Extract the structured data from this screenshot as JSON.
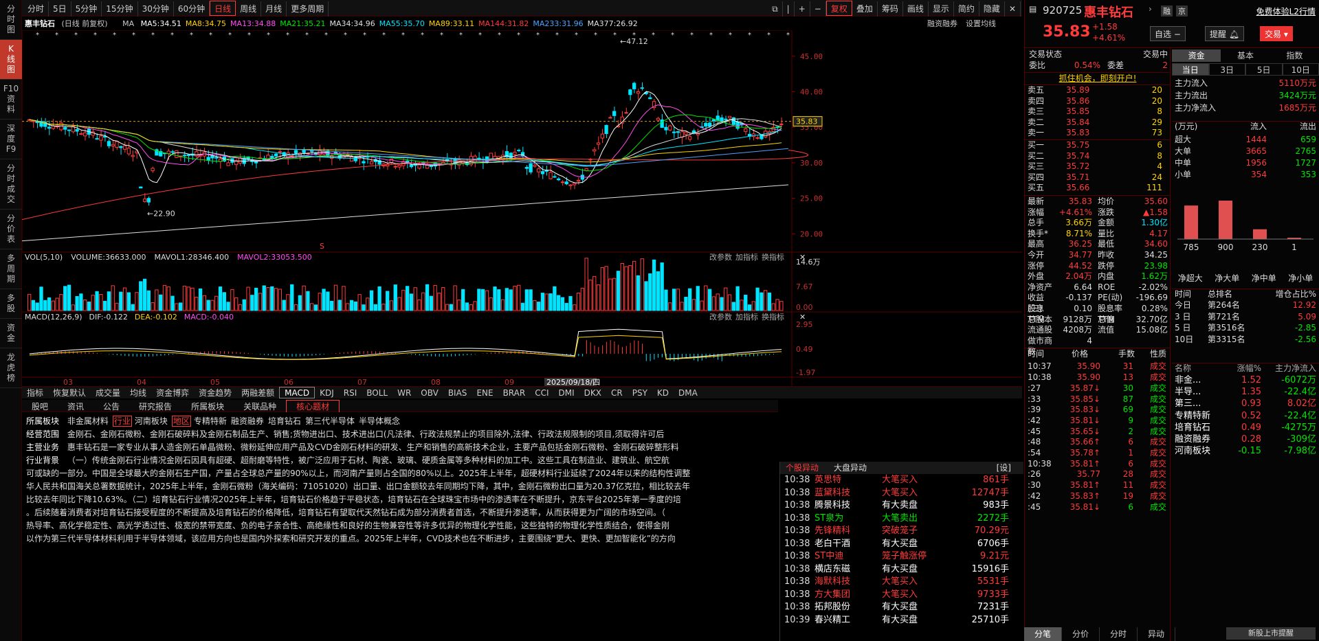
{
  "leftnav": [
    "分时图",
    "K线图",
    "F10资料",
    "深度F9",
    "分时成交",
    "分价表",
    "多周期",
    "多股",
    "资金",
    "龙虎榜"
  ],
  "topbar": {
    "periods": [
      "分时",
      "5日",
      "5分钟",
      "15分钟",
      "30分钟",
      "60分钟",
      "日线",
      "周线",
      "月线",
      "更多周期"
    ],
    "active": "日线",
    "right_items": [
      "复权",
      "叠加",
      "筹码",
      "画线",
      "显示",
      "简约",
      "隐藏"
    ]
  },
  "chart_header": {
    "name": "惠丰钻石",
    "mode": "(日线 前复权)",
    "ma_label": "MA",
    "ma": [
      {
        "label": "MA5:34.51",
        "color": "#ffffff"
      },
      {
        "label": "MA8:34.75",
        "color": "#ffd400"
      },
      {
        "label": "MA13:34.88",
        "color": "#ff4df0"
      },
      {
        "label": "MA21:35.21",
        "color": "#00e600"
      },
      {
        "label": "MA34:34.96",
        "color": "#e0e0e0"
      },
      {
        "label": "MA55:35.70",
        "color": "#00e5ff"
      },
      {
        "label": "MA89:33.11",
        "color": "#ffd400"
      },
      {
        "label": "MA144:31.82",
        "color": "#ff3b3b"
      },
      {
        "label": "MA233:31.96",
        "color": "#4da3ff"
      },
      {
        "label": "MA377:26.92",
        "color": "#e0e0e0"
      }
    ],
    "right_links": [
      "融资融券",
      "设置均线"
    ]
  },
  "price_axis": [
    "45.00",
    "40.00",
    "35.00",
    "30.00",
    "25.00",
    "20.00"
  ],
  "current_price_tag": "35.83",
  "high_label": "47.12",
  "low_label": "22.90",
  "vol_header": {
    "label": "VOL(5,10)",
    "volume": "VOLUME:36633.000",
    "mavol1": "MAVOL1:28346.400",
    "mavol2": "MAVOL2:33053.500",
    "links": [
      "改参数",
      "加指标",
      "换指标"
    ],
    "axis": [
      "14.6万",
      "7.67",
      "0.00"
    ]
  },
  "macd_header": {
    "label": "MACD(12,26,9)",
    "dif": "DIF:-0.122",
    "dea": "DEA:-0.102",
    "macd": "MACD:-0.040",
    "links": [
      "改参数",
      "加指标",
      "换指标"
    ],
    "axis": [
      "2.95",
      "0.49",
      "-1.97"
    ]
  },
  "month_labels": [
    "03",
    "04",
    "05",
    "06",
    "07",
    "08",
    "09"
  ],
  "date_tag": "2025/09/18/四",
  "indicator_tabs": [
    "指标",
    "恢复默认",
    "成交量",
    "均线",
    "资金博弈",
    "资金趋势",
    "两融差额",
    "MACD",
    "KDJ",
    "RSI",
    "BOLL",
    "WR",
    "OBV",
    "BIAS",
    "ENE",
    "BRAR",
    "CCI",
    "DMI",
    "DKX",
    "CR",
    "PSY",
    "KD",
    "DMA"
  ],
  "info_tabs": [
    "股吧",
    "资讯",
    "公告",
    "研究报告",
    "所属板块",
    "关联品种",
    "核心题材"
  ],
  "info_active": "核心题材",
  "info": {
    "sector_label": "所属板块",
    "sector_items": [
      "非金属材料",
      "行业",
      "河南板块",
      "地区",
      "专精特新",
      "融资融券",
      "培育钻石",
      "第三代半导体",
      "半导体概念"
    ],
    "scope_label": "经营范围",
    "scope": "金刚石、金刚石微粉、金刚石破碎料及金刚石制品生产、销售;货物进出口、技术进出口(凡法律、行政法规禁止的项目除外,法律、行政法规限制的项目,须取得许可后",
    "biz_label": "主营业务",
    "biz": "惠丰钻石是一家专业从事人造金刚石单晶微粉、微粉延伸应用产品及CVD金刚石材料的研发、生产和销售的高新技术企业，主要产品包括金刚石微粉、金刚石破碎整形料",
    "bg_label": "行业背景",
    "bg1": "（一）传统金刚石行业情况金刚石因具有超硬、超耐磨等特性，被广泛应用于石材、陶瓷、玻璃、硬质金属等多种材料的加工中。这些工具在制造业、建筑业、航空航",
    "lines": [
      "可或缺的一部分。中国是全球最大的金刚石生产国，产量占全球总产量的90%以上，而河南产量则占全国的80%以上。2025年上半年，超硬材料行业延续了2024年以来的结构性调整",
      "华人民共和国海关总署数据统计，2025年上半年，金刚石微粉（海关编码：71051020）出口量、出口金额较去年同期均下降，其中，金刚石微粉出口量为20.37亿克拉，相比较去年",
      "比较去年同比下降10.63%。（二）培育钻石行业情况2025年上半年，培育钻石价格趋于平稳状态，培育钻石在全球珠宝市场中的渗透率在不断提升，京东平台2025年第一季度的培",
      "。后续随着消费者对培育钻石接受程度的不断提高及培育钻石的价格降低，培育钻石有望取代天然钻石成为部分消费者首选，不断提升渗透率，从而获得更为广阔的市场空间。（",
      "热导率、高化学稳定性、高光学透过性、极宽的禁带宽度、负的电子亲合性、高绝缘性和良好的生物兼容性等许多优异的物理化学性能，这些独特的物理化学性质结合，使得金刚",
      "以作为第三代半导体材料利用于半导体领域，该应用方向也是国内外探索和研究开发的重点。2025年上半年，CVD技术也在不断进步，主要围绕“更大、更快、更加智能化”的方向"
    ]
  },
  "alerts": {
    "tabs": [
      "个股异动",
      "大盘异动"
    ],
    "settings": "[设]",
    "rows": [
      {
        "time": "10:38",
        "name": "英思特",
        "name_color": "#ff3b3b",
        "type": "大笔买入",
        "type_color": "#ff3b3b",
        "vol": "861手",
        "vol_color": "#ff3b3b"
      },
      {
        "time": "10:38",
        "name": "蓝黛科技",
        "name_color": "#ff3b3b",
        "type": "大笔买入",
        "type_color": "#ff3b3b",
        "vol": "12747手",
        "vol_color": "#ff3b3b"
      },
      {
        "time": "10:38",
        "name": "腾景科技",
        "name_color": "#ffffff",
        "type": "有大卖盘",
        "type_color": "#ffffff",
        "vol": "983手",
        "vol_color": "#ffffff"
      },
      {
        "time": "10:38",
        "name": "ST泉为",
        "name_color": "#00e600",
        "type": "大笔卖出",
        "type_color": "#00e600",
        "vol": "2272手",
        "vol_color": "#00e600"
      },
      {
        "time": "10:38",
        "name": "先锋精科",
        "name_color": "#ff3b3b",
        "type": "突破笼子",
        "type_color": "#ff3b3b",
        "vol": "70.29元",
        "vol_color": "#ff3b3b"
      },
      {
        "time": "10:38",
        "name": "老白干酒",
        "name_color": "#ffffff",
        "type": "有大买盘",
        "type_color": "#ffffff",
        "vol": "6706手",
        "vol_color": "#ffffff"
      },
      {
        "time": "10:38",
        "name": "ST中迪",
        "name_color": "#ff3b3b",
        "type": "笼子触涨停",
        "type_color": "#ff3b3b",
        "vol": "9.21元",
        "vol_color": "#ff3b3b"
      },
      {
        "time": "10:38",
        "name": "横店东磁",
        "name_color": "#ffffff",
        "type": "有大买盘",
        "type_color": "#ffffff",
        "vol": "15916手",
        "vol_color": "#ffffff"
      },
      {
        "time": "10:38",
        "name": "海默科技",
        "name_color": "#ff3b3b",
        "type": "大笔买入",
        "type_color": "#ff3b3b",
        "vol": "5531手",
        "vol_color": "#ff3b3b"
      },
      {
        "time": "10:38",
        "name": "方大集团",
        "name_color": "#ff3b3b",
        "type": "大笔买入",
        "type_color": "#ff3b3b",
        "vol": "9733手",
        "vol_color": "#ff3b3b"
      },
      {
        "time": "10:38",
        "name": "拓邦股份",
        "name_color": "#ffffff",
        "type": "有大买盘",
        "type_color": "#ffffff",
        "vol": "7231手",
        "vol_color": "#ffffff"
      },
      {
        "time": "10:39",
        "name": "春兴精工",
        "name_color": "#ffffff",
        "type": "有大买盘",
        "type_color": "#ffffff",
        "vol": "25710手",
        "vol_color": "#ffffff"
      }
    ]
  },
  "stock": {
    "code": "920725",
    "name": "惠丰钻石",
    "price": "35.83",
    "change": "+1.58",
    "change_pct": "+4.61%",
    "tags": [
      "融",
      "京"
    ],
    "free_l2": "免费体验L2行情",
    "btn_select": "自选",
    "btn_alert": "提醒",
    "btn_trade": "交易"
  },
  "orderbook": {
    "title": "交易状态",
    "status": "交易中",
    "weibi_label": "委比",
    "weibi": "0.54%",
    "weicha_label": "委差",
    "weicha": "2",
    "promo": "抓住机会，即刻开户!",
    "sells": [
      {
        "label": "卖五",
        "price": "35.89",
        "vol": "20"
      },
      {
        "label": "卖四",
        "price": "35.86",
        "vol": "20"
      },
      {
        "label": "卖三",
        "price": "35.85",
        "vol": "8"
      },
      {
        "label": "卖二",
        "price": "35.84",
        "vol": "29"
      },
      {
        "label": "卖一",
        "price": "35.83",
        "vol": "73"
      }
    ],
    "buys": [
      {
        "label": "买一",
        "price": "35.75",
        "vol": "6"
      },
      {
        "label": "买二",
        "price": "35.74",
        "vol": "8"
      },
      {
        "label": "买三",
        "price": "35.72",
        "vol": "4"
      },
      {
        "label": "买四",
        "price": "35.71",
        "vol": "24"
      },
      {
        "label": "买五",
        "price": "35.66",
        "vol": "111"
      }
    ]
  },
  "quote_stats": [
    [
      {
        "l": "最新",
        "v": "35.83",
        "c": "#ff3b3b"
      },
      {
        "l": "均价",
        "v": "35.60",
        "c": "#ff3b3b"
      }
    ],
    [
      {
        "l": "涨幅",
        "v": "+4.61%",
        "c": "#ff3b3b"
      },
      {
        "l": "涨跌",
        "v": "▲1.58",
        "c": "#ff3b3b"
      }
    ],
    [
      {
        "l": "总手",
        "v": "3.66万",
        "c": "#ffd400"
      },
      {
        "l": "金额",
        "v": "1.30亿",
        "c": "#00e5ff"
      }
    ],
    [
      {
        "l": "换手*",
        "v": "8.71%",
        "c": "#ffd400"
      },
      {
        "l": "量比",
        "v": "4.17",
        "c": "#ff3b3b"
      }
    ],
    [
      {
        "l": "最高",
        "v": "36.25",
        "c": "#ff3b3b"
      },
      {
        "l": "最低",
        "v": "34.60",
        "c": "#ff3b3b"
      }
    ],
    [
      {
        "l": "今开",
        "v": "34.77",
        "c": "#ff3b3b"
      },
      {
        "l": "昨收",
        "v": "34.25",
        "c": "#dddddd"
      }
    ],
    [
      {
        "l": "涨停",
        "v": "44.52",
        "c": "#ff3b3b"
      },
      {
        "l": "跌停",
        "v": "23.98",
        "c": "#00e600"
      }
    ],
    [
      {
        "l": "外盘",
        "v": "2.04万",
        "c": "#ff3b3b"
      },
      {
        "l": "内盘",
        "v": "1.62万",
        "c": "#00e600"
      }
    ],
    [
      {
        "l": "净资产",
        "v": "6.64",
        "c": "#dddddd"
      },
      {
        "l": "ROE",
        "v": "-2.02%",
        "c": "#dddddd"
      }
    ],
    [
      {
        "l": "收益(三)",
        "v": "-0.137",
        "c": "#dddddd"
      },
      {
        "l": "PE(动)",
        "v": "-196.69",
        "c": "#dddddd"
      }
    ],
    [
      {
        "l": "股息TTM",
        "v": "0.10",
        "c": "#dddddd"
      },
      {
        "l": "股息率TTM",
        "v": "0.28%",
        "c": "#dddddd"
      }
    ],
    [
      {
        "l": "总股本",
        "v": "9128万",
        "c": "#dddddd"
      },
      {
        "l": "总值",
        "v": "32.70亿",
        "c": "#dddddd"
      }
    ],
    [
      {
        "l": "流通股",
        "v": "4208万",
        "c": "#dddddd"
      },
      {
        "l": "流值",
        "v": "15.08亿",
        "c": "#dddddd"
      }
    ],
    [
      {
        "l": "做市商数",
        "v": "4",
        "c": "#dddddd"
      },
      {
        "l": "",
        "v": "",
        "c": "#dddddd"
      }
    ]
  ],
  "ticks": {
    "headers": [
      "时间",
      "价格",
      "手数",
      "性质"
    ],
    "rows": [
      {
        "t": "10:37",
        "p": "35.90",
        "v": "31",
        "k": "成交",
        "vc": "#ff3b3b"
      },
      {
        "t": "10:38",
        "p": "35.90",
        "v": "13",
        "k": "成交",
        "vc": "#ff3b3b"
      },
      {
        "t": ":27",
        "p": "35.87↓",
        "v": "30",
        "k": "成交",
        "vc": "#00e600"
      },
      {
        "t": ":33",
        "p": "35.85↓",
        "v": "87",
        "k": "成交",
        "vc": "#00e600"
      },
      {
        "t": ":39",
        "p": "35.83↓",
        "v": "69",
        "k": "成交",
        "vc": "#00e600"
      },
      {
        "t": ":42",
        "p": "35.81↓",
        "v": "9",
        "k": "成交",
        "vc": "#00e600"
      },
      {
        "t": ":45",
        "p": "35.65↓",
        "v": "2",
        "k": "成交",
        "vc": "#00e600"
      },
      {
        "t": ":48",
        "p": "35.66↑",
        "v": "6",
        "k": "成交",
        "vc": "#ff3b3b"
      },
      {
        "t": ":54",
        "p": "35.78↑",
        "v": "1",
        "k": "成交",
        "vc": "#ff3b3b"
      },
      {
        "t": "10:38",
        "p": "35.81↑",
        "v": "6",
        "k": "成交",
        "vc": "#ff3b3b"
      },
      {
        "t": ":26",
        "p": "35.77",
        "v": "28",
        "k": "成交",
        "vc": "#ff3b3b"
      },
      {
        "t": ":30",
        "p": "35.81↑",
        "v": "11",
        "k": "成交",
        "vc": "#ff3b3b"
      },
      {
        "t": ":42",
        "p": "35.83↑",
        "v": "19",
        "k": "成交",
        "vc": "#ff3b3b"
      },
      {
        "t": ":45",
        "p": "35.81↓",
        "v": "6",
        "k": "成交",
        "vc": "#00e600"
      }
    ]
  },
  "fund": {
    "tabs": [
      "资金",
      "基本",
      "指数"
    ],
    "periods": [
      "当日",
      "3日",
      "5日",
      "10日"
    ],
    "flows": [
      {
        "l": "主力流入",
        "v": "5110万元",
        "c": "#ff3b3b"
      },
      {
        "l": "主力流出",
        "v": "3424万元",
        "c": "#00e600"
      },
      {
        "l": "主力净流入",
        "v": "1685万元",
        "c": "#ff3b3b"
      }
    ],
    "unit": "(万元)",
    "inflow_h": "流入",
    "outflow_h": "流出",
    "sizes": [
      {
        "l": "超大",
        "in": "1444",
        "out": "659"
      },
      {
        "l": "大单",
        "in": "3665",
        "out": "2765"
      },
      {
        "l": "中单",
        "in": "1956",
        "out": "1727"
      },
      {
        "l": "小单",
        "in": "354",
        "out": "353"
      }
    ],
    "bars": [
      {
        "label": "785",
        "value": 785
      },
      {
        "label": "900",
        "value": 900
      },
      {
        "label": "230",
        "value": 230
      },
      {
        "label": "1",
        "value": 1
      }
    ],
    "bar_captions": [
      "净超大",
      "净大单",
      "净中单",
      "净小单"
    ],
    "rank_headers": [
      "时间",
      "总排名",
      "增仓占比%"
    ],
    "ranks": [
      {
        "t": "今日",
        "r": "第264名",
        "p": "12.92",
        "c": "#ff3b3b"
      },
      {
        "t": "3 日",
        "r": "第721名",
        "p": "5.09",
        "c": "#ff3b3b"
      },
      {
        "t": "5 日",
        "r": "第3516名",
        "p": "-2.85",
        "c": "#00e600"
      },
      {
        "t": "10日",
        "r": "第3315名",
        "p": "-2.56",
        "c": "#00e600"
      }
    ],
    "sector_headers": [
      "名称",
      "涨幅%",
      "主力净流入"
    ],
    "sectors": [
      {
        "n": "非金...",
        "p": "1.52",
        "f": "-6072万",
        "pc": "#ff3b3b",
        "fc": "#00e600"
      },
      {
        "n": "半导...",
        "p": "1.35",
        "f": "-22.4亿",
        "pc": "#ff3b3b",
        "fc": "#00e600"
      },
      {
        "n": "第三...",
        "p": "0.93",
        "f": "8.02亿",
        "pc": "#ff3b3b",
        "fc": "#ff3b3b"
      },
      {
        "n": "专精特新",
        "p": "0.52",
        "f": "-22.4亿",
        "pc": "#ff3b3b",
        "fc": "#00e600"
      },
      {
        "n": "培育钻石",
        "p": "0.49",
        "f": "-4275万",
        "pc": "#ff3b3b",
        "fc": "#00e600"
      },
      {
        "n": "融资融券",
        "p": "0.28",
        "f": "-309亿",
        "pc": "#ff3b3b",
        "fc": "#00e600"
      },
      {
        "n": "河南板块",
        "p": "-0.15",
        "f": "-7.98亿",
        "pc": "#00e600",
        "fc": "#00e600"
      }
    ]
  },
  "bottom_tabs": [
    "分笔",
    "分价",
    "分时",
    "异动"
  ],
  "bottom_notice": "新股上市提醒"
}
